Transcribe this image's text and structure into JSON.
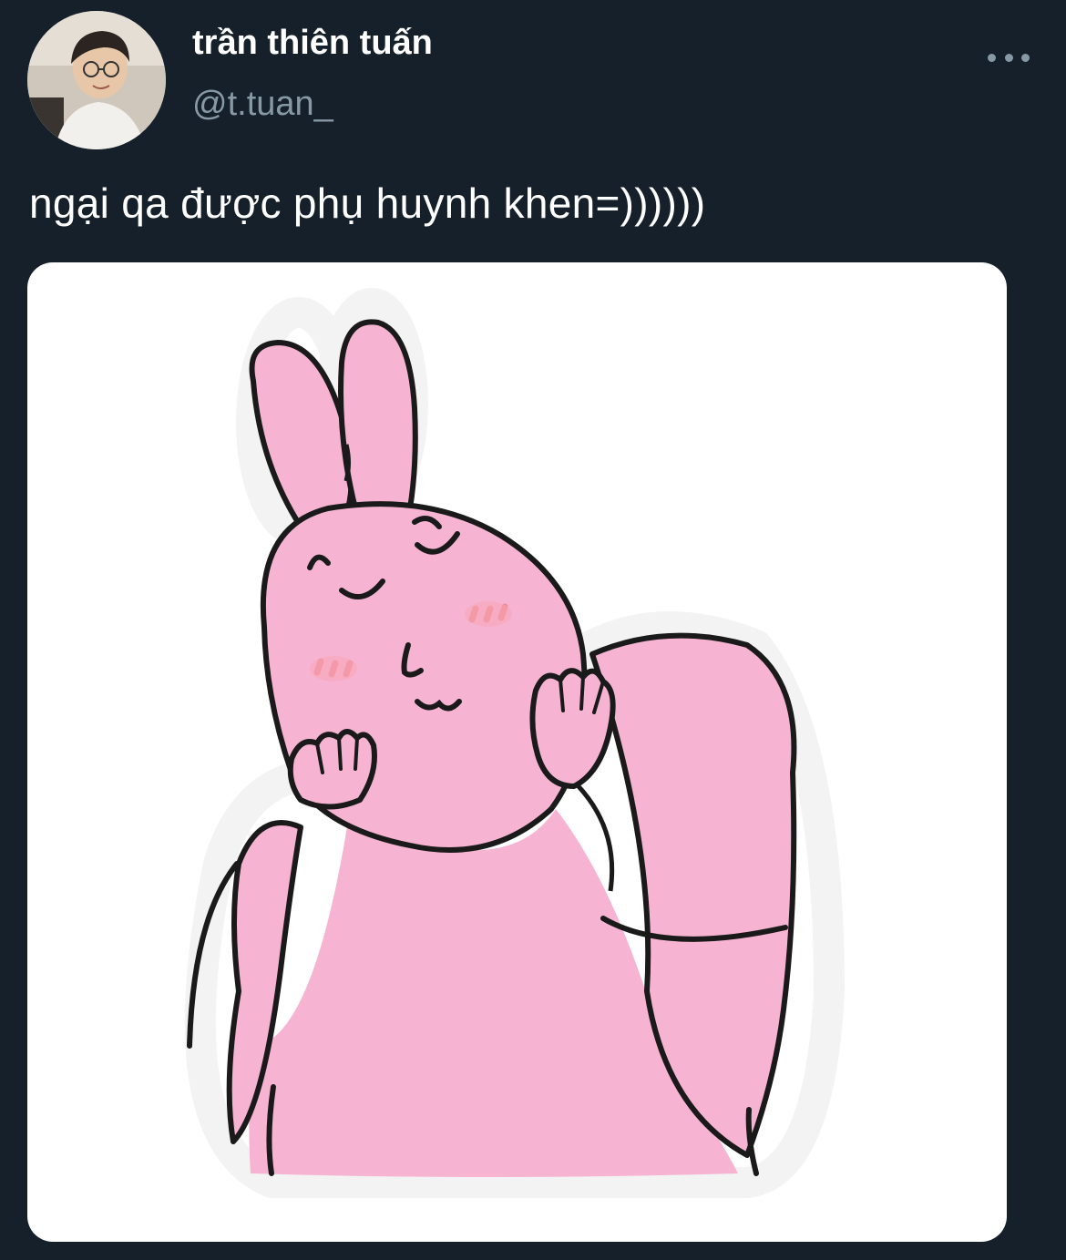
{
  "tweet": {
    "author": {
      "display_name": "trần thiên tuấn",
      "handle": "@t.tuan_"
    },
    "more_icon": "more-horizontal-icon",
    "text": "ngại qa được phụ huynh khen=))))))",
    "media": {
      "type": "image",
      "subject": "pink bunny sticker blushing with hands on cheeks"
    }
  },
  "colors": {
    "background": "#15202b",
    "primary_text": "#ffffff",
    "secondary_text": "#8899a6",
    "bunny_pink": "#f6b4d2",
    "outline": "#1a1a1a",
    "blush": "#ee8a96"
  }
}
